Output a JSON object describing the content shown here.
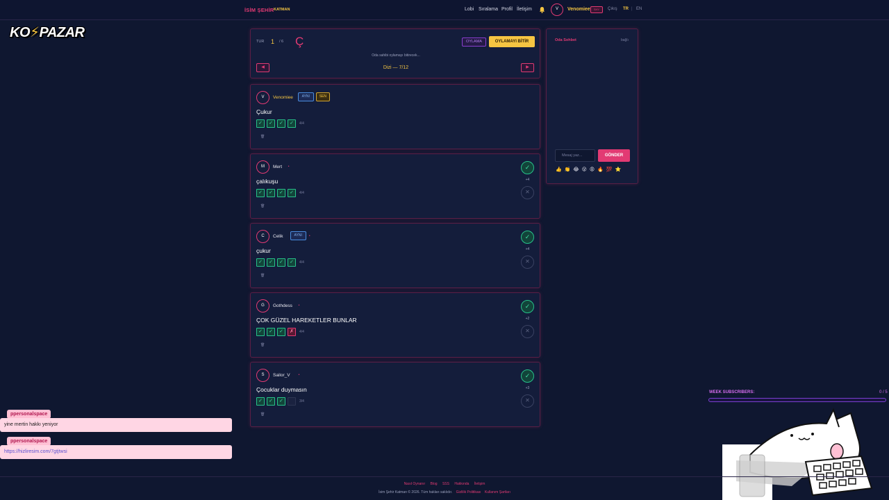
{
  "nav": {
    "brand": "İSİM ŞEHİR",
    "brand_tag": "KATMAN",
    "links": [
      "Lobi",
      "Sıralama",
      "Profil",
      "İletişim"
    ],
    "bell_icon": "bell-icon",
    "user_initial": "V",
    "username": "Venomiee",
    "user_badge": "SHY",
    "logout": "Çıkış",
    "lang_tr": "TR",
    "lang_sep": "|",
    "lang_en": "EN"
  },
  "overlay_logo": {
    "part1": "KO",
    "bolt": "⚡",
    "part2": "PAZAR"
  },
  "round": {
    "tur_label": "TUR",
    "tur_num": "1",
    "tur_total": "/ 6",
    "letter": "Ç",
    "oylama_label": "OYLAMA",
    "finish_label": "OYLAMAYI BİTİR",
    "note": "Oda sahibi oylamayı bitirecek...",
    "prev_icon": "◀",
    "next_icon": "▶",
    "category": "Dizi — 7/12"
  },
  "answers": [
    {
      "initial": "V",
      "name": "Venomiee",
      "tags": [
        "AYNI",
        "SEN"
      ],
      "dot": "",
      "answer": "Çukur",
      "votes": [
        "yes",
        "yes",
        "yes",
        "yes"
      ],
      "count": "4/4",
      "score": "",
      "trash": "🗑",
      "self": true
    },
    {
      "initial": "M",
      "name": "Mert",
      "tags": [],
      "dot": "•",
      "answer": "çalıkuşu",
      "votes": [
        "yes",
        "yes",
        "yes",
        "yes"
      ],
      "count": "4/4",
      "score": "+4",
      "trash": "🗑",
      "self": false
    },
    {
      "initial": "C",
      "name": "Celik",
      "tags": [
        "AYNI"
      ],
      "dot": "•",
      "answer": "çukur",
      "votes": [
        "yes",
        "yes",
        "yes",
        "yes"
      ],
      "count": "4/4",
      "score": "+4",
      "trash": "🗑",
      "self": false
    },
    {
      "initial": "G",
      "name": "Gothdess",
      "tags": [],
      "dot": "•",
      "answer": "ÇOK GÜZEL HAREKETLER BUNLAR",
      "votes": [
        "yes",
        "yes",
        "yes",
        "no"
      ],
      "count": "4/4",
      "score": "+2",
      "trash": "🗑",
      "self": false
    },
    {
      "initial": "S",
      "name": "Sailor_V",
      "tags": [],
      "dot": "•",
      "answer": "Çocuklar duymasın",
      "votes": [
        "yes",
        "yes",
        "yes",
        "empty"
      ],
      "count": "3/4",
      "score": "+3",
      "trash": "🗑",
      "self": false
    }
  ],
  "chat": {
    "title": "Oda Sohbet",
    "status": "bağlı",
    "placeholder": "Mesaj yaz...",
    "send": "GÖNDER",
    "emojis": "👍👏😂😮😡🔥💯⭐"
  },
  "stream_chat": [
    {
      "user": "ppersonalspace",
      "text": "yine mertin hakkı yeniyor",
      "link": false
    },
    {
      "user": "ppersonalspace",
      "text": "https://hizliresim.com/7gtjtwsi",
      "link": true
    }
  ],
  "subs": {
    "label": "WEEK SUBSCRIBERS:",
    "count": "0 / 5",
    "progress": 0.0
  },
  "footer": {
    "links": [
      "Nasıl Oynanır",
      "Blog",
      "SSS",
      "Hakkında",
      "İletişim"
    ],
    "copy": "İsim Şehir Katman © 2026. Tüm hakları saklıdır.",
    "policies": [
      "Gizlilik Politikası",
      "Kullanım Şartları"
    ]
  },
  "colors": {
    "accent": "#e23a73",
    "gold": "#f5c542",
    "green": "#27c28a",
    "bg": "#0f1730",
    "panel": "#141d3b"
  }
}
